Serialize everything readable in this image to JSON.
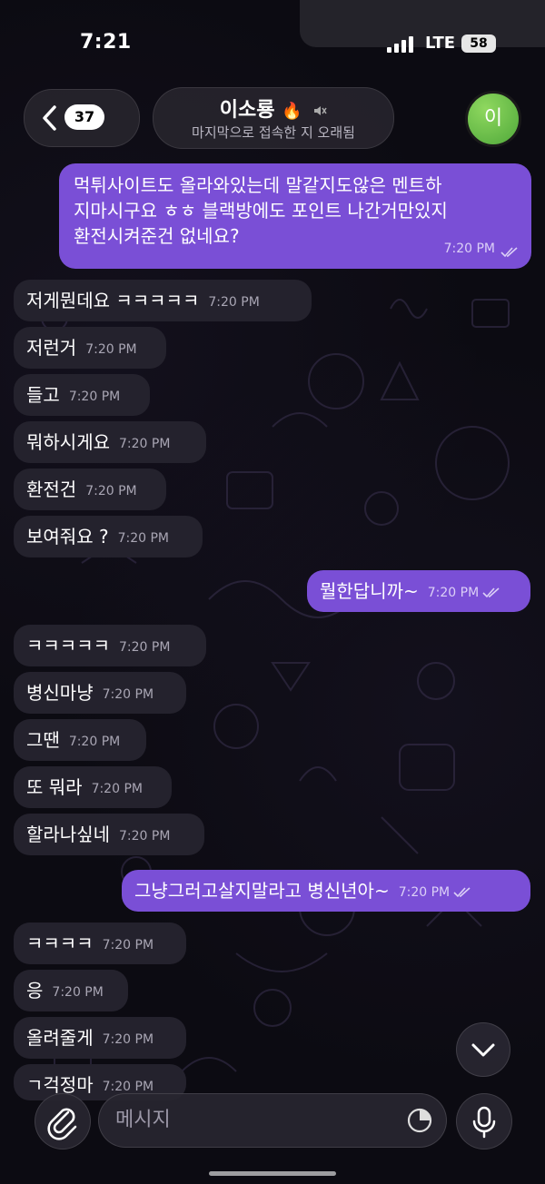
{
  "status_bar": {
    "time": "7:21",
    "network": "LTE",
    "battery": "58"
  },
  "header": {
    "back_badge": "37",
    "title": "이소룡",
    "title_emoji": "🔥",
    "status": "마지막으로 접속한 지 오래됨",
    "avatar_letter": "이"
  },
  "messages": [
    {
      "dir": "out",
      "text": "먹튀사이트도 올라와있는데 말같지도않은 멘트하\n지마시구요 ㅎㅎ 블랙방에도 포인트 나간거만있지\n환전시켜준건 없네요?",
      "time": "7:20 PM"
    },
    {
      "dir": "in",
      "text": "저게뭔데요 ㅋㅋㅋㅋㅋ",
      "time": "7:20 PM"
    },
    {
      "dir": "in",
      "text": "저런거",
      "time": "7:20 PM"
    },
    {
      "dir": "in",
      "text": "들고",
      "time": "7:20 PM"
    },
    {
      "dir": "in",
      "text": "뭐하시게요",
      "time": "7:20 PM"
    },
    {
      "dir": "in",
      "text": "환전건",
      "time": "7:20 PM"
    },
    {
      "dir": "in",
      "text": "보여줘요 ?",
      "time": "7:20 PM"
    },
    {
      "dir": "out",
      "text": "뭘한답니까~",
      "time": "7:20 PM"
    },
    {
      "dir": "in",
      "text": "ㅋㅋㅋㅋㅋ",
      "time": "7:20 PM"
    },
    {
      "dir": "in",
      "text": "병신마냥",
      "time": "7:20 PM"
    },
    {
      "dir": "in",
      "text": "그땐",
      "time": "7:20 PM"
    },
    {
      "dir": "in",
      "text": "또 뭐라",
      "time": "7:20 PM"
    },
    {
      "dir": "in",
      "text": "할라나싶네",
      "time": "7:20 PM"
    },
    {
      "dir": "out",
      "text": "그냥그러고살지말라고 병신년아~",
      "time": "7:20 PM"
    },
    {
      "dir": "in",
      "text": "ㅋㅋㅋㅋ",
      "time": "7:20 PM"
    },
    {
      "dir": "in",
      "text": "응",
      "time": "7:20 PM"
    },
    {
      "dir": "in",
      "text": "올려줄게",
      "time": "7:20 PM"
    },
    {
      "dir": "in",
      "text": "ㄱ걱정마",
      "time": "7:20 PM"
    }
  ],
  "composer": {
    "placeholder": "메시지"
  },
  "colors": {
    "outgoing": "#7a4fd6",
    "incoming": "#24222d",
    "avatar": "#6cc44a"
  },
  "icons": [
    "back-chevron-icon",
    "mute-icon",
    "read-checks-icon",
    "attach-icon",
    "sticker-icon",
    "mic-icon",
    "chevron-down-icon"
  ]
}
